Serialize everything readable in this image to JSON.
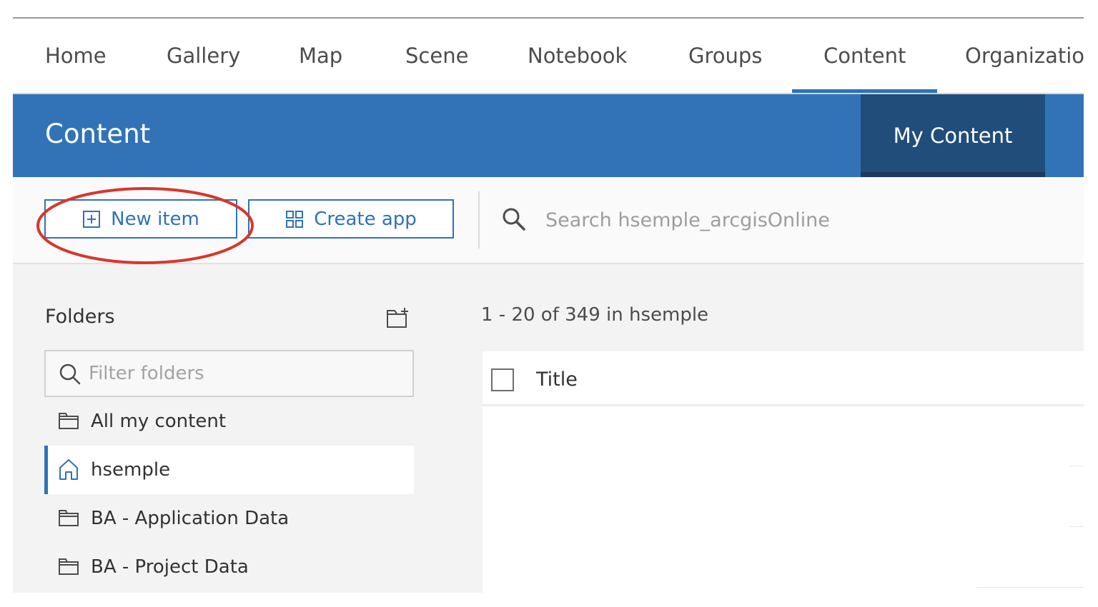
{
  "nav": {
    "items": [
      {
        "label": "Home"
      },
      {
        "label": "Gallery"
      },
      {
        "label": "Map"
      },
      {
        "label": "Scene"
      },
      {
        "label": "Notebook"
      },
      {
        "label": "Groups"
      },
      {
        "label": "Content",
        "active": true
      },
      {
        "label": "Organization"
      }
    ]
  },
  "header": {
    "title": "Content",
    "tab": "My Content"
  },
  "toolbar": {
    "new_item_label": "New item",
    "create_app_label": "Create app",
    "search_placeholder": "Search hsemple_arcgisOnline"
  },
  "folders": {
    "title": "Folders",
    "filter_placeholder": "Filter folders",
    "items": [
      {
        "label": "All my content",
        "icon": "folder-icon"
      },
      {
        "label": "hsemple",
        "icon": "home-icon",
        "selected": true
      },
      {
        "label": "BA - Application Data",
        "icon": "folder-icon"
      },
      {
        "label": "BA - Project Data",
        "icon": "folder-icon"
      }
    ]
  },
  "results": {
    "count_text": "1 - 20 of 349 in hsemple"
  },
  "table": {
    "columns": [
      "Title"
    ]
  },
  "colors": {
    "accent": "#2f72b8",
    "header_blue": "#3273b8",
    "header_tab_dark": "#214d7a",
    "annotation_red": "#d9362b"
  }
}
